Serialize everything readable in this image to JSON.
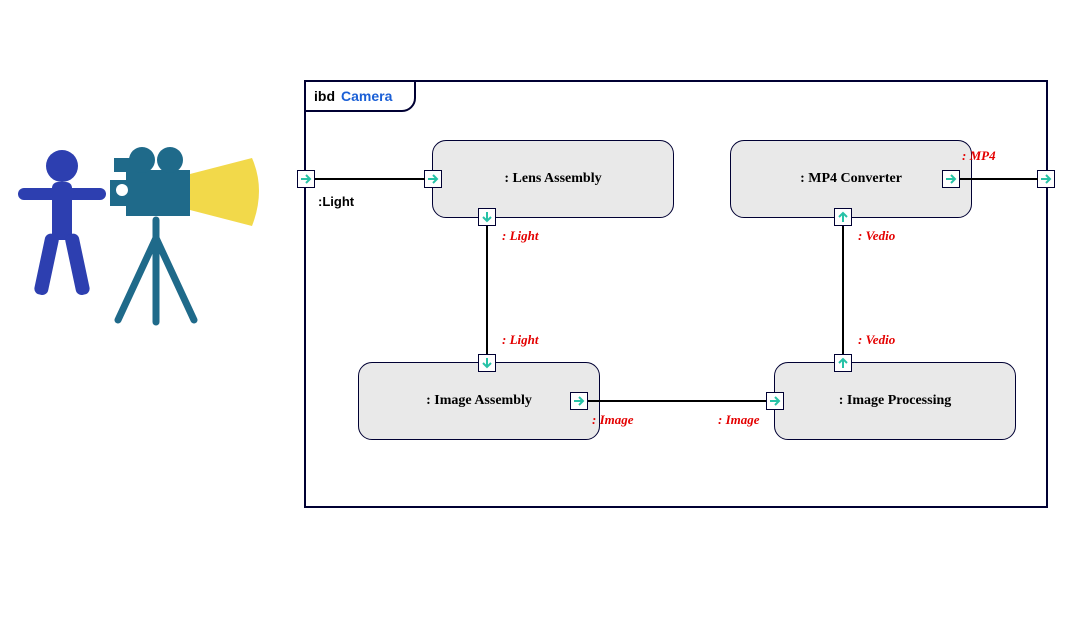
{
  "frame": {
    "kind": "ibd",
    "name": "Camera"
  },
  "blocks": {
    "lens": ": Lens Assembly",
    "mp4": ": MP4 Converter",
    "imgasm": ": Image Assembly",
    "imgproc": ": Image Processing"
  },
  "labels": {
    "light_in": ":Light",
    "light1": ": Light",
    "light2": ": Light",
    "image1": ": Image",
    "image2": ": Image",
    "vedio1": ": Vedio",
    "vedio2": ": Vedio",
    "mp4_out": ": MP4"
  },
  "icons": {
    "port_right": "port-arrow-right",
    "port_down": "port-arrow-down",
    "port_up": "port-arrow-up",
    "person": "person-icon",
    "camera": "camera-on-tripod-icon"
  }
}
